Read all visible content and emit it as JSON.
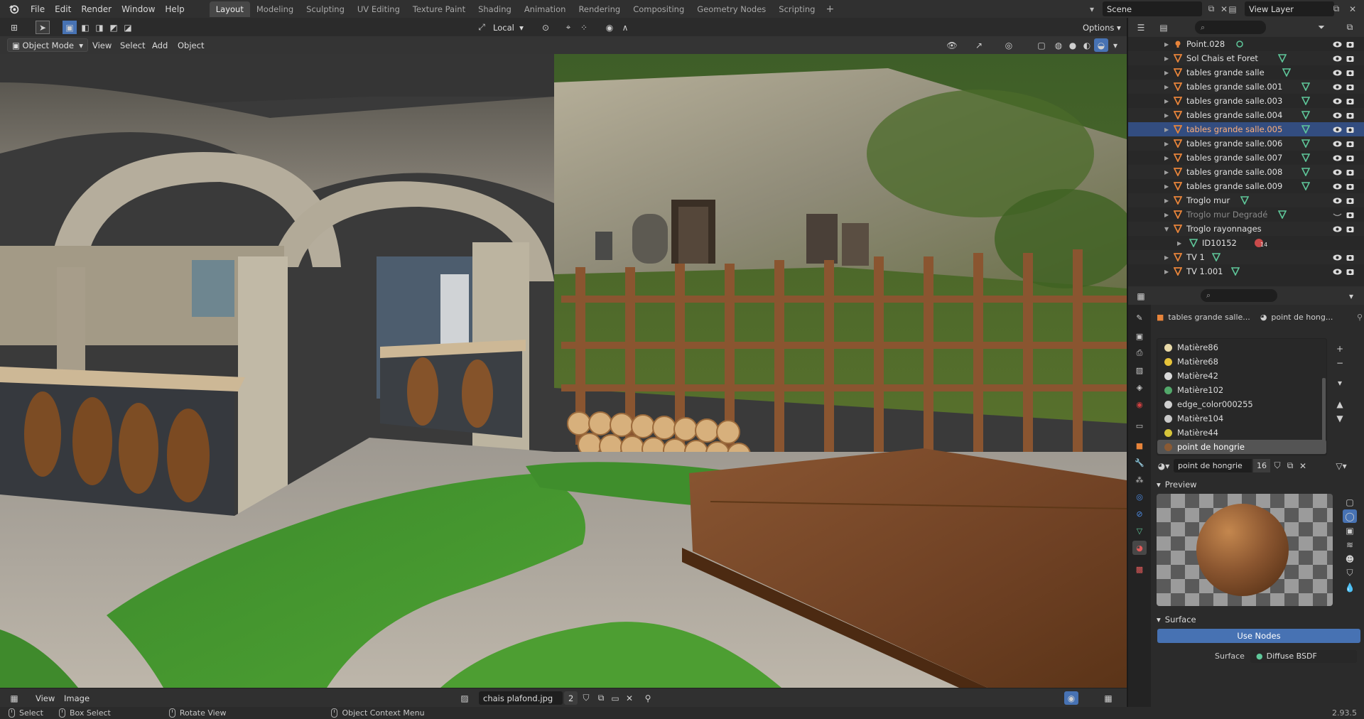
{
  "app": {
    "menus": [
      "File",
      "Edit",
      "Render",
      "Window",
      "Help"
    ],
    "workspace_tabs": [
      "Layout",
      "Modeling",
      "Sculpting",
      "UV Editing",
      "Texture Paint",
      "Shading",
      "Animation",
      "Rendering",
      "Compositing",
      "Geometry Nodes",
      "Scripting"
    ],
    "active_tab": "Layout",
    "add_tab": "+",
    "scene": "Scene",
    "view_layer": "View Layer"
  },
  "viewport": {
    "mode": "Object Mode",
    "menus": [
      "View",
      "Select",
      "Add",
      "Object"
    ],
    "transform_orientation": "Local",
    "options": "Options"
  },
  "image_editor": {
    "menus": [
      "View",
      "Image"
    ],
    "image_name": "chais plafond.jpg",
    "users": "2"
  },
  "status_bar": {
    "select": "Select",
    "box_select": "Box Select",
    "rotate_view": "Rotate View",
    "context_menu": "Object Context Menu",
    "version": "2.93.5"
  },
  "outliner": {
    "items": [
      {
        "label": "Point.028",
        "kind": "light",
        "expand": "closed",
        "visible": true
      },
      {
        "label": "Sol Chais et Foret",
        "kind": "mesh",
        "expand": "closed",
        "visible": true
      },
      {
        "label": "tables grande salle",
        "kind": "mesh",
        "expand": "closed",
        "visible": true
      },
      {
        "label": "tables grande salle.001",
        "kind": "mesh",
        "expand": "closed",
        "visible": true
      },
      {
        "label": "tables grande salle.003",
        "kind": "mesh",
        "expand": "closed",
        "visible": true
      },
      {
        "label": "tables grande salle.004",
        "kind": "mesh",
        "expand": "closed",
        "visible": true
      },
      {
        "label": "tables grande salle.005",
        "kind": "mesh",
        "expand": "closed",
        "visible": true,
        "selected": true
      },
      {
        "label": "tables grande salle.006",
        "kind": "mesh",
        "expand": "closed",
        "visible": true
      },
      {
        "label": "tables grande salle.007",
        "kind": "mesh",
        "expand": "closed",
        "visible": true
      },
      {
        "label": "tables grande salle.008",
        "kind": "mesh",
        "expand": "closed",
        "visible": true
      },
      {
        "label": "tables grande salle.009",
        "kind": "mesh",
        "expand": "closed",
        "visible": true
      },
      {
        "label": "Troglo mur",
        "kind": "mesh",
        "expand": "closed",
        "visible": true
      },
      {
        "label": "Troglo mur Degradé",
        "kind": "mesh",
        "expand": "closed",
        "visible": false
      },
      {
        "label": "Troglo rayonnages",
        "kind": "none",
        "expand": "open",
        "visible": true
      },
      {
        "label": "ID10152",
        "kind": "mesh-child",
        "expand": "closed",
        "visible": null,
        "badge": "14"
      },
      {
        "label": "TV 1",
        "kind": "mesh",
        "expand": "closed",
        "visible": true
      },
      {
        "label": "TV 1.001",
        "kind": "mesh",
        "expand": "closed",
        "visible": true
      }
    ]
  },
  "properties": {
    "object_name": "tables grande salle...",
    "material_name_short": "point de hong...",
    "materials": [
      {
        "name": "Matière86",
        "color": "#e8d9a8"
      },
      {
        "name": "Matière68",
        "color": "#e6c33a"
      },
      {
        "name": "Matière42",
        "color": "#d9d9d9"
      },
      {
        "name": "Matière102",
        "color": "#52a86a"
      },
      {
        "name": "edge_color000255",
        "color": "#cfcfcf"
      },
      {
        "name": "Matière104",
        "color": "#c9c9c9"
      },
      {
        "name": "Matière44",
        "color": "#d6c43a"
      },
      {
        "name": "point de hongrie",
        "color": "#8a5a34",
        "selected": true
      }
    ],
    "material_field": "point de hongrie",
    "material_users": "16",
    "preview_label": "Preview",
    "surface_label": "Surface",
    "use_nodes": "Use Nodes",
    "surface_field_label": "Surface",
    "surface_shader": "Diffuse BSDF"
  },
  "colors": {
    "accent": "#4772b3",
    "selection": "#334d80",
    "object_orange": "#e8843a",
    "mesh_green": "#5fc79a"
  }
}
